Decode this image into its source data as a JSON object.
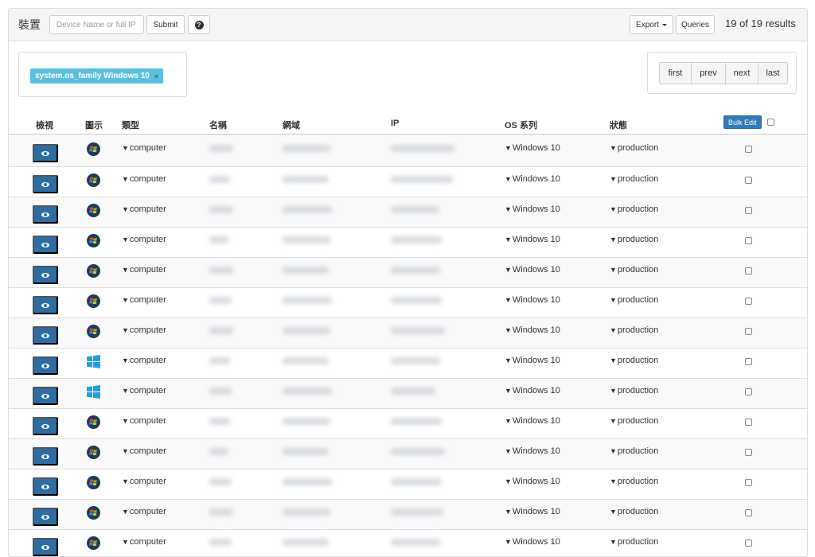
{
  "header": {
    "title": "裝置",
    "search_placeholder": "Device Name or full IP",
    "submit_label": "Submit",
    "help_label": "?",
    "export_label": "Export",
    "queries_label": "Queries",
    "results_text": "19 of 19 results"
  },
  "filter": {
    "tag_label": "system.os_family Windows 10",
    "close_label": "×"
  },
  "pager": {
    "first": "first",
    "prev": "prev",
    "next": "next",
    "last": "last"
  },
  "table": {
    "columns": {
      "view": "檢視",
      "icon": "圖示",
      "type": "類型",
      "name": "名稱",
      "domain": "網域",
      "ip": "IP",
      "os_family": "OS 系列",
      "status": "狀態"
    },
    "bulk_edit_label": "Bulk Edit",
    "rows": [
      {
        "icon": "windows-7-logo-icon",
        "type": "computer",
        "os": "Windows 10",
        "status": "production"
      },
      {
        "icon": "windows-7-logo-icon",
        "type": "computer",
        "os": "Windows 10",
        "status": "production"
      },
      {
        "icon": "windows-7-logo-icon",
        "type": "computer",
        "os": "Windows 10",
        "status": "production"
      },
      {
        "icon": "windows-7-logo-icon",
        "type": "computer",
        "os": "Windows 10",
        "status": "production"
      },
      {
        "icon": "windows-7-logo-icon",
        "type": "computer",
        "os": "Windows 10",
        "status": "production"
      },
      {
        "icon": "windows-7-logo-icon",
        "type": "computer",
        "os": "Windows 10",
        "status": "production"
      },
      {
        "icon": "windows-7-logo-icon",
        "type": "computer",
        "os": "Windows 10",
        "status": "production"
      },
      {
        "icon": "windows-10-logo-icon",
        "type": "computer",
        "os": "Windows 10",
        "status": "production"
      },
      {
        "icon": "windows-10-logo-icon",
        "type": "computer",
        "os": "Windows 10",
        "status": "production"
      },
      {
        "icon": "windows-7-logo-icon",
        "type": "computer",
        "os": "Windows 10",
        "status": "production"
      },
      {
        "icon": "windows-7-logo-icon",
        "type": "computer",
        "os": "Windows 10",
        "status": "production"
      },
      {
        "icon": "windows-7-logo-icon",
        "type": "computer",
        "os": "Windows 10",
        "status": "production"
      },
      {
        "icon": "windows-7-logo-icon",
        "type": "computer",
        "os": "Windows 10",
        "status": "production"
      },
      {
        "icon": "windows-7-logo-icon",
        "type": "computer",
        "os": "Windows 10",
        "status": "production"
      }
    ]
  },
  "colors": {
    "primary": "#2e6da4",
    "filter_tag": "#5bc0de",
    "win7_red": "#e8462a",
    "win7_green": "#7cbb2c",
    "win7_blue": "#1ea0e0",
    "win7_yellow": "#fbbc09",
    "win10_blue": "#1ba1e2"
  }
}
